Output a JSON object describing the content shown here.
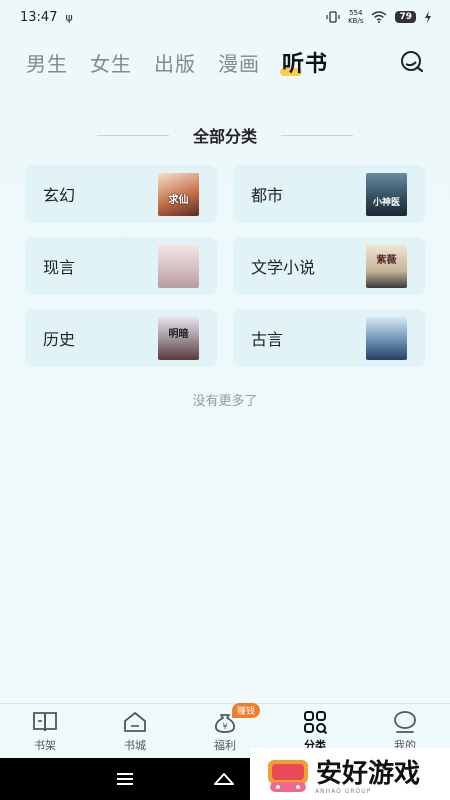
{
  "status_bar": {
    "time": "13:47",
    "usb": "ψ",
    "speed_value": "554",
    "speed_unit": "KB/s",
    "battery": "79"
  },
  "tabs": [
    {
      "label": "男生",
      "active": false
    },
    {
      "label": "女生",
      "active": false
    },
    {
      "label": "出版",
      "active": false
    },
    {
      "label": "漫画",
      "active": false
    },
    {
      "label": "听书",
      "active": true
    }
  ],
  "section_title": "全部分类",
  "categories": [
    {
      "label": "玄幻",
      "cover_text": "求仙",
      "cover_color": "#c9724a"
    },
    {
      "label": "都市",
      "cover_text": "小神医",
      "cover_color": "#2f4a5a"
    },
    {
      "label": "现言",
      "cover_text": "",
      "cover_color": "#d8c3c6"
    },
    {
      "label": "文学小说",
      "cover_text": "紫薇",
      "cover_color": "#c7b59a"
    },
    {
      "label": "历史",
      "cover_text": "明暗",
      "cover_color": "#8a6c70"
    },
    {
      "label": "古言",
      "cover_text": "",
      "cover_color": "#6a8fb4"
    }
  ],
  "no_more_text": "没有更多了",
  "bottom_nav": [
    {
      "label": "书架",
      "icon": "bookshelf-icon"
    },
    {
      "label": "书城",
      "icon": "home-icon"
    },
    {
      "label": "福利",
      "icon": "money-bag-icon",
      "badge": "赚钱"
    },
    {
      "label": "分类",
      "icon": "category-icon",
      "active": true
    },
    {
      "label": "我的",
      "icon": "profile-icon"
    }
  ],
  "watermark": {
    "text": "安好游戏",
    "sub": "ANHAO GROUP"
  }
}
